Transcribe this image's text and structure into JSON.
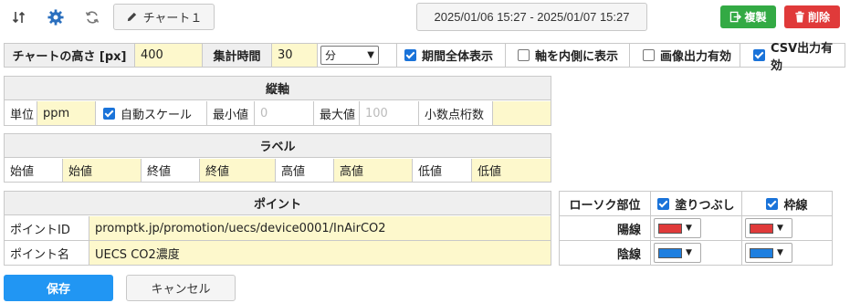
{
  "toolbar": {
    "chart_label": "チャート１",
    "date_range": "2025/01/06 15:27 - 2025/01/07 15:27",
    "copy_label": "複製",
    "delete_label": "削除"
  },
  "settings": {
    "height_label": "チャートの高さ [px]",
    "height_value": "400",
    "interval_label": "集計時間",
    "interval_value": "30",
    "interval_unit": "分",
    "opt_full_period": "期間全体表示",
    "opt_axis_inside": "軸を内側に表示",
    "opt_image_export": "画像出力有効",
    "opt_csv_export": "CSV出力有効"
  },
  "vaxis": {
    "title": "縦軸",
    "unit_label": "単位",
    "unit_value": "ppm",
    "auto_scale": "自動スケール",
    "min_label": "最小値",
    "min_placeholder": "0",
    "max_label": "最大値",
    "max_placeholder": "100",
    "decimals_label": "小数点桁数",
    "decimals_value": ""
  },
  "labels": {
    "title": "ラベル",
    "open_label": "始値",
    "open_value": "始値",
    "close_label": "終値",
    "close_value": "終値",
    "high_label": "高値",
    "high_value": "高値",
    "low_label": "低値",
    "low_value": "低値"
  },
  "point": {
    "title": "ポイント",
    "id_label": "ポイントID",
    "id_value": "promptk.jp/promotion/uecs/device0001/InAirCO2",
    "name_label": "ポイント名",
    "name_value": "UECS CO2濃度"
  },
  "candle": {
    "title": "ローソク部位",
    "fill_label": "塗りつぶし",
    "border_label": "枠線",
    "up_label": "陽線",
    "down_label": "陰線",
    "colors": {
      "up": "#e03a3a",
      "down": "#1e7fe0"
    }
  },
  "actions": {
    "save_label": "保存",
    "cancel_label": "キャンセル"
  }
}
